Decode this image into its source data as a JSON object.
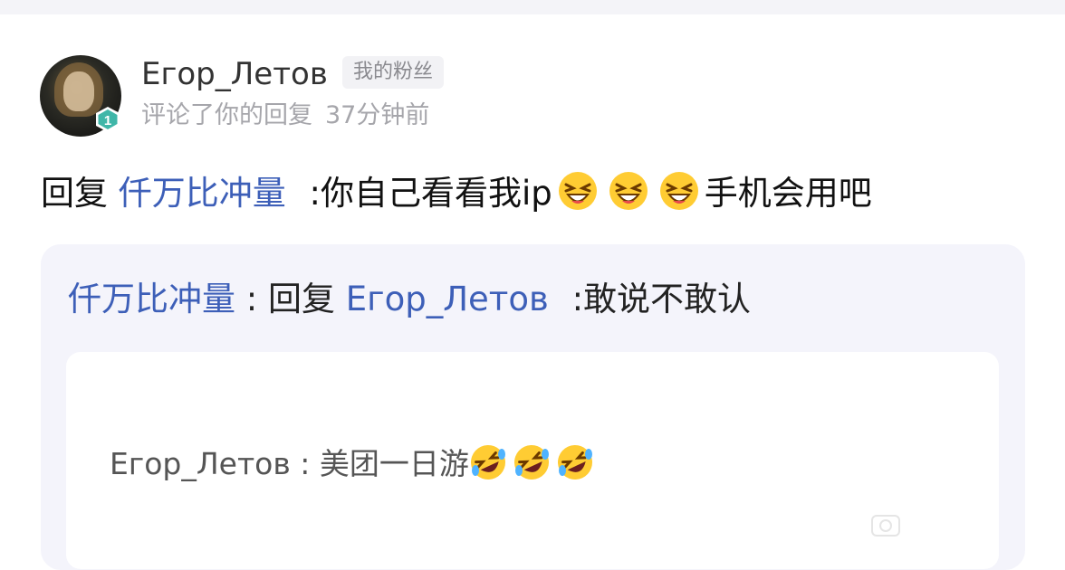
{
  "comment": {
    "username": "Егор_Летов",
    "fan_tag": "我的粉丝",
    "level": "1",
    "action": "评论了你的回复",
    "time": "37分钟前",
    "reply_prefix": "回复",
    "reply_target": "仟万比冲量",
    "reply_text_before_emoji": ":你自己看看我ip",
    "reply_text_after_emoji": "手机会用吧",
    "emoji_name": "grinning-squint-emoji"
  },
  "quoted": {
    "author": "仟万比冲量",
    "separator": " : ",
    "reply_prefix": "回复",
    "reply_target": "Егор_Летов",
    "text": ":敢说不敢认"
  },
  "original": {
    "author": "Егор_Летов",
    "separator": " : ",
    "text": "美团一日游",
    "emoji_name": "rolling-laughing-emoji"
  },
  "colors": {
    "link": "#3d5fb8",
    "quote_bg": "#f4f4fb",
    "level_badge": "#3fb6a8"
  }
}
